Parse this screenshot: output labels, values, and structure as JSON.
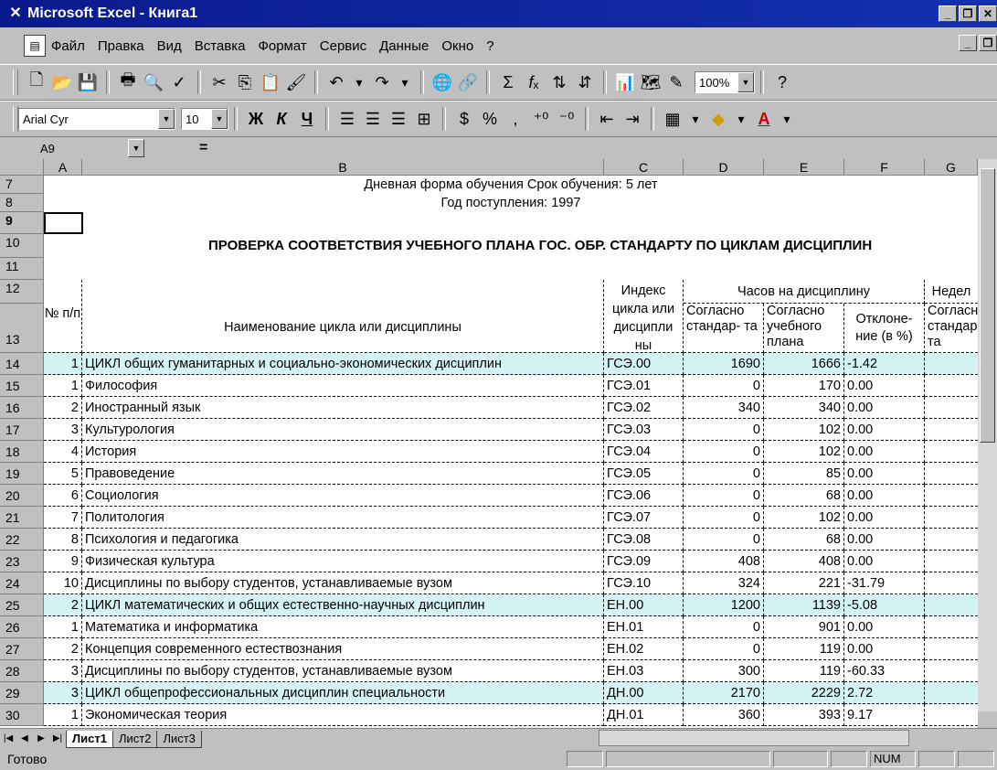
{
  "window": {
    "title": "Microsoft Excel - Книга1",
    "buttons": [
      "_",
      "б",
      "x"
    ]
  },
  "menu": {
    "items": [
      "Файл",
      "Правка",
      "Вид",
      "Вставка",
      "Формат",
      "Сервис",
      "Данные",
      "Окно",
      "?"
    ]
  },
  "toolbar": {
    "zoom": "100%",
    "font_name": "Arial Cyr",
    "font_size": "10"
  },
  "formula_bar": {
    "cell_ref": "A9",
    "equals": "=",
    "value": ""
  },
  "columns": [
    "A",
    "B",
    "C",
    "D",
    "E",
    "F",
    "G"
  ],
  "sheet": {
    "row7_text": "Дневная форма обучения   Срок обучения:  5 лет",
    "row8_text": "Год поступления: 1997",
    "row10_text": "ПРОВЕРКА СООТВЕТСТВИЯ УЧЕБНОГО ПЛАНА ГОС. ОБР. СТАНДАРТУ  ПО ЦИКЛАМ ДИСЦИПЛИН",
    "header": {
      "num_label": "№ п/п",
      "name_label": "Наименование цикла или дисциплины",
      "index_label": "Индекс цикла или дисципли ны",
      "hours_group": "Часов на дисциплину",
      "std_label": "Согласно стандар- та",
      "plan_label": "Согласно учебного плана",
      "dev_label": "Отклоне- ние (в %)",
      "weeks_group": "Недел",
      "g_std_label": "Согласн стандар- та"
    },
    "rows": [
      {
        "row": "14",
        "num": "1",
        "name": "ЦИКЛ общих гуманитарных и социально-экономических дисциплин",
        "index": "ГСЭ.00",
        "std": "1690",
        "plan": "1666",
        "dev": "-1.42",
        "hl": true
      },
      {
        "row": "15",
        "num": "1",
        "name": "Философия",
        "index": "ГСЭ.01",
        "std": "0",
        "plan": "170",
        "dev": "0.00",
        "hl": false
      },
      {
        "row": "16",
        "num": "2",
        "name": "Иностранный язык",
        "index": "ГСЭ.02",
        "std": "340",
        "plan": "340",
        "dev": "0.00",
        "hl": false
      },
      {
        "row": "17",
        "num": "3",
        "name": "Культурология",
        "index": "ГСЭ.03",
        "std": "0",
        "plan": "102",
        "dev": "0.00",
        "hl": false
      },
      {
        "row": "18",
        "num": "4",
        "name": "История",
        "index": "ГСЭ.04",
        "std": "0",
        "plan": "102",
        "dev": "0.00",
        "hl": false
      },
      {
        "row": "19",
        "num": "5",
        "name": "Правоведение",
        "index": "ГСЭ.05",
        "std": "0",
        "plan": "85",
        "dev": "0.00",
        "hl": false
      },
      {
        "row": "20",
        "num": "6",
        "name": "Социология",
        "index": "ГСЭ.06",
        "std": "0",
        "plan": "68",
        "dev": "0.00",
        "hl": false
      },
      {
        "row": "21",
        "num": "7",
        "name": "Политология",
        "index": "ГСЭ.07",
        "std": "0",
        "plan": "102",
        "dev": "0.00",
        "hl": false
      },
      {
        "row": "22",
        "num": "8",
        "name": "Психология и педагогика",
        "index": "ГСЭ.08",
        "std": "0",
        "plan": "68",
        "dev": "0.00",
        "hl": false
      },
      {
        "row": "23",
        "num": "9",
        "name": "Физическая культура",
        "index": "ГСЭ.09",
        "std": "408",
        "plan": "408",
        "dev": "0.00",
        "hl": false
      },
      {
        "row": "24",
        "num": "10",
        "name": "Дисциплины по выбору студентов, устанавливаемые вузом",
        "index": "ГСЭ.10",
        "std": "324",
        "plan": "221",
        "dev": "-31.79",
        "hl": false
      },
      {
        "row": "25",
        "num": "2",
        "name": "ЦИКЛ математических и общих естественно-научных дисциплин",
        "index": "ЕН.00",
        "std": "1200",
        "plan": "1139",
        "dev": "-5.08",
        "hl": true
      },
      {
        "row": "26",
        "num": "1",
        "name": "Математика и информатика",
        "index": "ЕН.01",
        "std": "0",
        "plan": "901",
        "dev": "0.00",
        "hl": false
      },
      {
        "row": "27",
        "num": "2",
        "name": "Концепция современного естествознания",
        "index": "ЕН.02",
        "std": "0",
        "plan": "119",
        "dev": "0.00",
        "hl": false
      },
      {
        "row": "28",
        "num": "3",
        "name": "Дисциплины по выбору студентов, устанавливаемые вузом",
        "index": "ЕН.03",
        "std": "300",
        "plan": "119",
        "dev": "-60.33",
        "hl": false
      },
      {
        "row": "29",
        "num": "3",
        "name": "ЦИКЛ общепрофессиональных дисциплин специальности",
        "index": "ДН.00",
        "std": "2170",
        "plan": "2229",
        "dev": "2.72",
        "hl": true
      },
      {
        "row": "30",
        "num": "1",
        "name": "Экономическая теория",
        "index": "ДН.01",
        "std": "360",
        "plan": "393",
        "dev": "9.17",
        "hl": false
      }
    ]
  },
  "sheet_tabs": [
    "Лист1",
    "Лист2",
    "Лист3"
  ],
  "status": {
    "ready": "Готово",
    "num": "NUM"
  }
}
